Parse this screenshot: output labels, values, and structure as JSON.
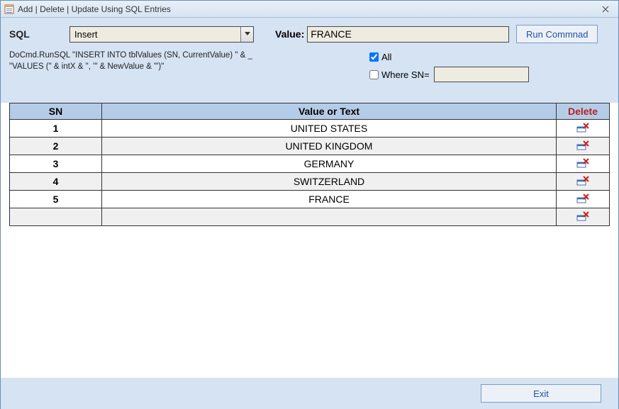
{
  "window": {
    "title": "Add | Delete | Update Using SQL Entries"
  },
  "form": {
    "sql_label": "SQL",
    "sql_selected": "Insert",
    "value_label": "Value:",
    "value_text": "FRANCE",
    "run_label": "Run Commnad",
    "sql_preview": "DoCmd.RunSQL \"INSERT INTO tblValues (SN, CurrentValue) \" & _\n\"VALUES (\" & intX & \", '\" & NewValue & \"')\"",
    "all_label": "All",
    "all_checked": true,
    "where_label": "Where SN=",
    "where_checked": false,
    "where_value": ""
  },
  "table": {
    "headers": {
      "sn": "SN",
      "value": "Value or Text",
      "delete": "Delete"
    },
    "rows": [
      {
        "sn": "1",
        "value": "UNITED STATES"
      },
      {
        "sn": "2",
        "value": "UNITED KINGDOM"
      },
      {
        "sn": "3",
        "value": "GERMANY"
      },
      {
        "sn": "4",
        "value": "SWITZERLAND"
      },
      {
        "sn": "5",
        "value": "FRANCE"
      },
      {
        "sn": "",
        "value": ""
      }
    ]
  },
  "footer": {
    "exit_label": "Exit"
  }
}
